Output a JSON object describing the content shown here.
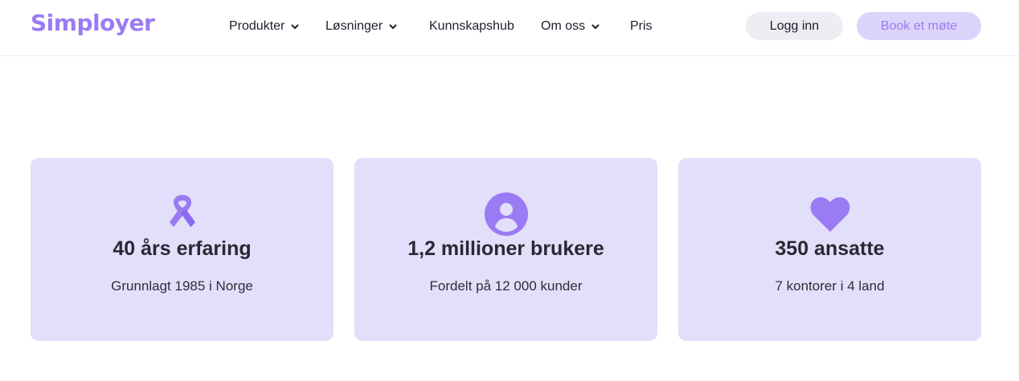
{
  "header": {
    "logo": "Simployer",
    "nav": [
      {
        "label": "Produkter",
        "has_dropdown": true
      },
      {
        "label": "Løsninger",
        "has_dropdown": true
      },
      {
        "label": "Kunnskapshub",
        "has_dropdown": false
      },
      {
        "label": "Om oss",
        "has_dropdown": true
      },
      {
        "label": "Pris",
        "has_dropdown": false
      }
    ],
    "login_label": "Logg inn",
    "book_label": "Book et møte"
  },
  "stats": [
    {
      "icon": "ribbon-icon",
      "title": "40 års erfaring",
      "subtitle": "Grunnlagt 1985 i Norge"
    },
    {
      "icon": "user-circle-icon",
      "title": "1,2 millioner brukere",
      "subtitle": "Fordelt på 12 000 kunder"
    },
    {
      "icon": "heart-icon",
      "title": "350 ansatte",
      "subtitle": "7 kontorer i 4 land"
    }
  ],
  "colors": {
    "brand": "#9b7bf3",
    "card_bg": "#e2dffa",
    "login_bg": "#ededf3",
    "book_bg": "#dcd5fb",
    "text": "#1f1d2b"
  }
}
